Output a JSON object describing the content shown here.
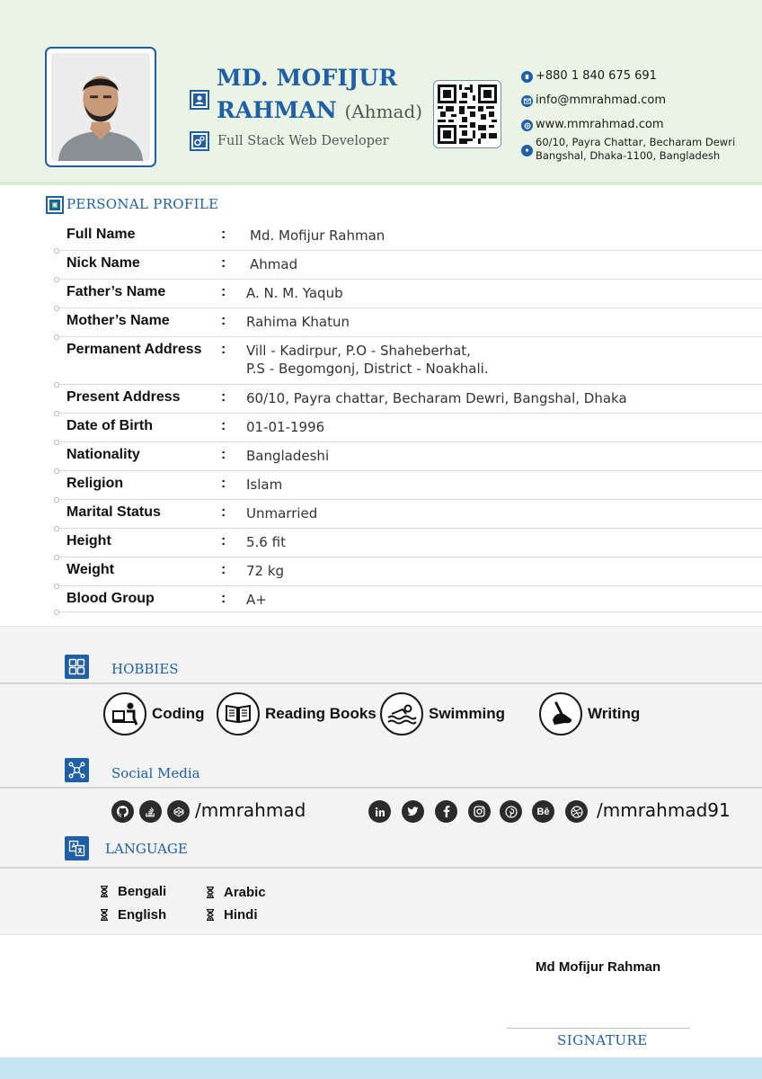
{
  "header": {
    "name_first": "MD. MOFIJUR",
    "name_last": "RAHMAN",
    "nick": "(Ahmad)",
    "role": "Full Stack Web Developer",
    "contacts": {
      "phone": "+880 1 840 675 691",
      "email": "info@mmrahmad.com",
      "website": "www.mmrahmad.com",
      "address_line1": "60/10, Payra Chattar, Becharam Dewri",
      "address_line2": "Bangshal, Dhaka-1100, Bangladesh"
    }
  },
  "profile": {
    "title": "PERSONAL PROFILE",
    "colon": ":",
    "rows": [
      {
        "label": "Full Name",
        "value": "Md. Mofijur Rahman"
      },
      {
        "label": "Nick Name",
        "value": "Ahmad"
      },
      {
        "label": "Father’s Name",
        "value": "A. N. M. Yaqub"
      },
      {
        "label": "Mother’s Name",
        "value": "Rahima Khatun"
      },
      {
        "label": "Permanent Address",
        "value": "Vill - Kadirpur, P.O - Shaheberhat,",
        "value2": "P.S - Begomgonj, District - Noakhali."
      },
      {
        "label": "Present Address",
        "value": "60/10, Payra chattar, Becharam Dewri, Bangshal, Dhaka"
      },
      {
        "label": "Date of Birth",
        "value": "01-01-1996"
      },
      {
        "label": "Nationality",
        "value": "Bangladeshi"
      },
      {
        "label": "Religion",
        "value": "Islam"
      },
      {
        "label": "Marital Status",
        "value": "Unmarried"
      },
      {
        "label": "Height",
        "value": "5.6 fit"
      },
      {
        "label": "Weight",
        "value": "72 kg"
      },
      {
        "label": "Blood Group",
        "value": "A+"
      }
    ]
  },
  "hobbies": {
    "title": "HOBBIES",
    "items": [
      "Coding",
      "Reading Books",
      "Swimming",
      "Writing"
    ]
  },
  "social": {
    "title": "Social Media",
    "handle_1": "/mmrahmad",
    "handle_2": "/mmrahmad91",
    "icons_1": [
      "github-icon",
      "stackoverflow-icon",
      "codepen-icon"
    ],
    "icons_2": [
      "linkedin-icon",
      "twitter-icon",
      "facebook-icon",
      "instagram-icon",
      "pinterest-icon",
      "behance-icon",
      "dribbble-icon"
    ],
    "behance_glyph": "Bē"
  },
  "language": {
    "title": "LANGUAGE",
    "items": [
      "Bengali",
      "Arabic",
      "English",
      "Hindi"
    ]
  },
  "signature": {
    "name": "Md Mofijur Rahman",
    "label": "SIGNATURE"
  },
  "colors": {
    "accent": "#1f5fa6",
    "header_bg": "#eaf4e4",
    "band_bg": "#f3f3f3",
    "footer_bg": "#c4e4f4"
  }
}
